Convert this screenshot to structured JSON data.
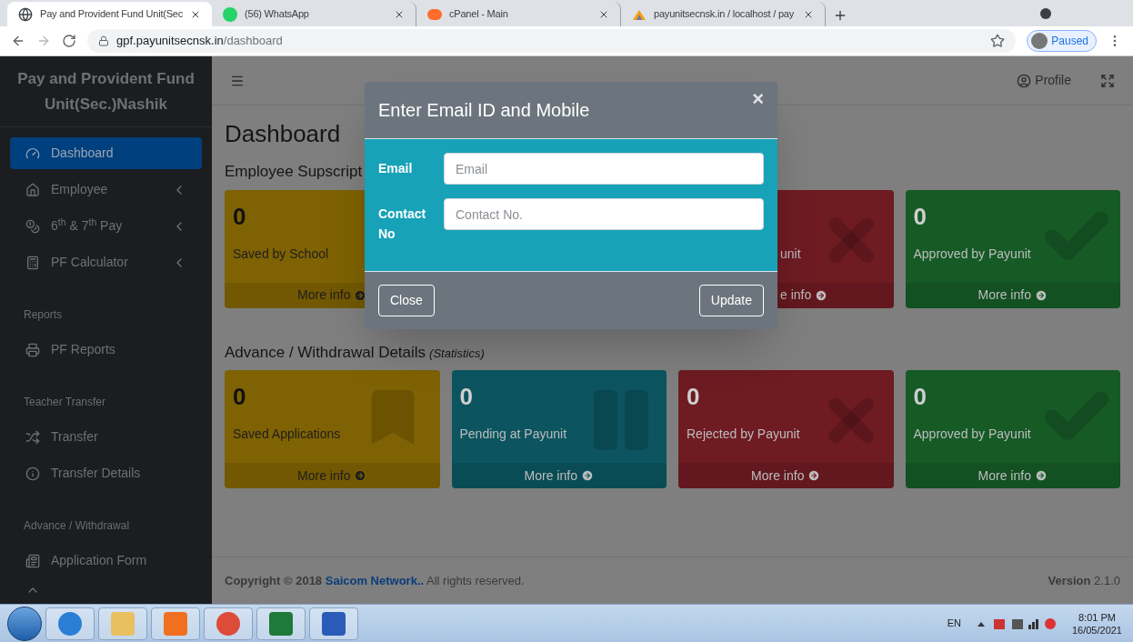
{
  "browser": {
    "tabs": [
      {
        "title": "Pay and Provident Fund Unit(Sec",
        "selected": true,
        "kind": "globe"
      },
      {
        "title": "(56) WhatsApp",
        "selected": false,
        "kind": "whatsapp"
      },
      {
        "title": "cPanel - Main",
        "selected": false,
        "kind": "cpanel"
      },
      {
        "title": "payunitsecnsk.in / localhost / pay",
        "selected": false,
        "kind": "pma"
      }
    ],
    "url_host": "gpf.payunitsecnsk.in",
    "url_path": "/dashboard",
    "profile_status": "Paused"
  },
  "sidebar": {
    "brand": "Pay and Provident Fund Unit(Sec.)Nashik",
    "items": [
      {
        "kind": "item",
        "label": "Dashboard",
        "selected": true,
        "expandable": false
      },
      {
        "kind": "item",
        "label": "Employee",
        "selected": false,
        "expandable": true
      },
      {
        "kind": "item",
        "label": "6$^{th}$ & 7$^{th}$ Pay",
        "selected": false,
        "expandable": true
      },
      {
        "kind": "item",
        "label": "PF Calculator",
        "selected": false,
        "expandable": true
      },
      {
        "kind": "header",
        "label": "Reports"
      },
      {
        "kind": "item",
        "label": "PF Reports",
        "selected": false,
        "expandable": false
      },
      {
        "kind": "header",
        "label": "Teacher Transfer"
      },
      {
        "kind": "item",
        "label": "Transfer",
        "selected": false,
        "expandable": false
      },
      {
        "kind": "item",
        "label": "Transfer Details",
        "selected": false,
        "expandable": false
      },
      {
        "kind": "header",
        "label": "Advance / Withdrawal"
      },
      {
        "kind": "item",
        "label": "Application Form",
        "selected": false,
        "expandable": false
      }
    ]
  },
  "header": {
    "profile": "Profile"
  },
  "page_title": "Dashboard",
  "sections": [
    {
      "title": "Employee Supscript",
      "cards": [
        {
          "kind": "saved",
          "color": "#7f6203",
          "value": "0",
          "label": "Saved by School",
          "more": "More info"
        },
        {
          "kind": "rejected",
          "color": "#6e1b22",
          "label": "unit",
          "more": "e info"
        },
        {
          "kind": "approved",
          "color": "#165a26",
          "value": "0",
          "label": "Approved by Payunit",
          "more": "More info"
        }
      ]
    },
    {
      "title": "Advance / Withdrawal Details",
      "subtitle": "(Statistics)",
      "cards": [
        {
          "kind": "saved",
          "color": "#7f6203",
          "value": "0",
          "label": "Saved Applications",
          "more": "More info"
        },
        {
          "kind": "pending",
          "color": "#0c5560",
          "value": "0",
          "label": "Pending at Payunit",
          "more": "More info"
        },
        {
          "kind": "rejected",
          "color": "#6e1b22",
          "value": "0",
          "label": "Rejected by Payunit",
          "more": "More info"
        },
        {
          "kind": "approved",
          "color": "#165a26",
          "value": "0",
          "label": "Approved by Payunit",
          "more": "More info"
        }
      ]
    }
  ],
  "footer": {
    "copyright": "**Copyright © 2018**",
    "link": "Saicom Network..",
    "rights": "All rights reserved.",
    "version": "**Version** 2.1.0"
  },
  "modal": {
    "title": "Enter Email ID and Mobile",
    "close_symbol": "×",
    "fields": [
      {
        "label": "Email",
        "placeholder": "Email"
      },
      {
        "label": "Contact No",
        "placeholder": "Contact No."
      }
    ],
    "close_button": "Close",
    "update_button": "Update"
  },
  "taskbar": {
    "language": "EN",
    "time": "8:01 PM",
    "date": "16/05/2021"
  }
}
